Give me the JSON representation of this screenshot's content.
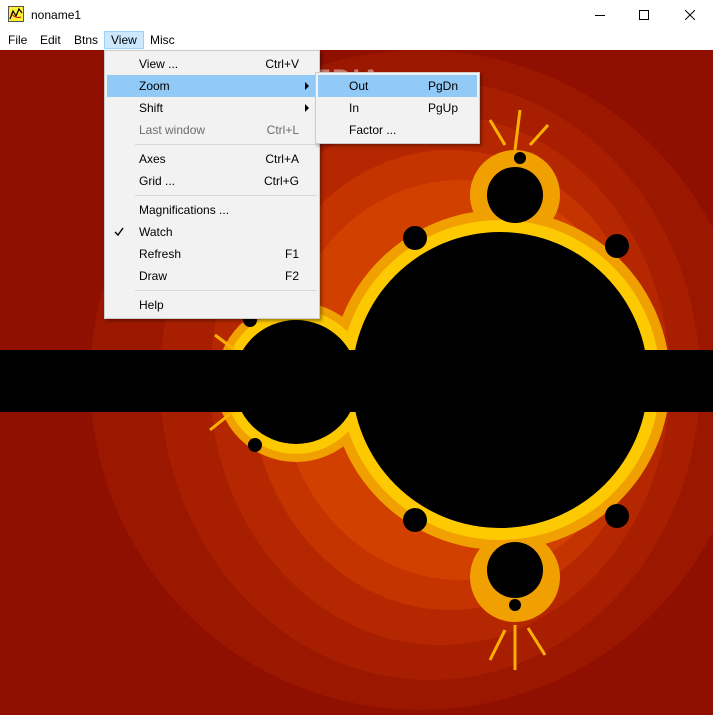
{
  "window": {
    "title": "noname1"
  },
  "menubar": {
    "items": [
      "File",
      "Edit",
      "Btns",
      "View",
      "Misc"
    ]
  },
  "view_menu": {
    "items": [
      {
        "label": "View ...",
        "shortcut": "Ctrl+V"
      },
      {
        "label": "Zoom",
        "submenu": true,
        "highlighted": true
      },
      {
        "label": "Shift",
        "submenu": true
      },
      {
        "label": "Last window",
        "shortcut": "Ctrl+L",
        "disabled": true
      },
      {
        "label": "Axes",
        "shortcut": "Ctrl+A"
      },
      {
        "label": "Grid ...",
        "shortcut": "Ctrl+G"
      },
      {
        "label": "Magnifications ..."
      },
      {
        "label": "Watch",
        "checked": true
      },
      {
        "label": "Refresh",
        "shortcut": "F1"
      },
      {
        "label": "Draw",
        "shortcut": "F2"
      },
      {
        "label": "Help"
      }
    ]
  },
  "zoom_submenu": {
    "items": [
      {
        "label": "Out",
        "shortcut": "PgDn",
        "highlighted": true
      },
      {
        "label": "In",
        "shortcut": "PgUp"
      },
      {
        "label": "Factor ..."
      }
    ]
  },
  "watermark": "SOFTPEDIA",
  "colors": {
    "fractal_background": "#8f0f00",
    "fractal_set": "#000000",
    "fractal_edge": "#f5a000",
    "menu_highlight": "#91c9f7",
    "menubar_active": "#cce8ff"
  }
}
